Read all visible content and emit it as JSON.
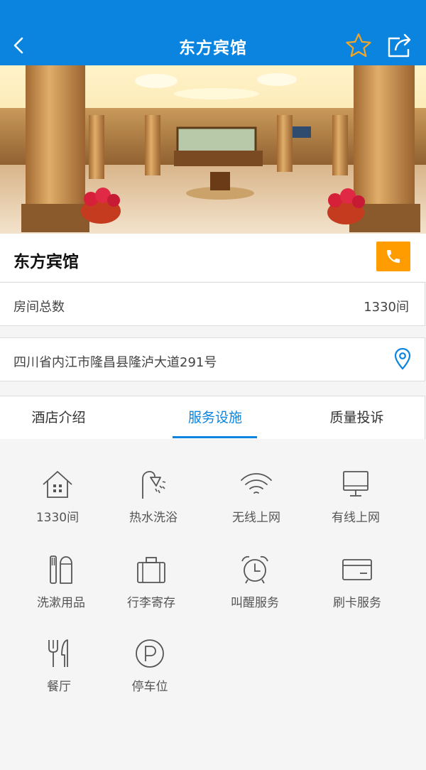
{
  "header": {
    "title": "东方宾馆",
    "back_icon": "back-arrow-icon",
    "favorite_icon": "star-icon",
    "share_icon": "share-icon",
    "bg_color": "#0a84de",
    "star_color": "#f5a623"
  },
  "hotel": {
    "name": "东方宾馆",
    "phone_icon": "phone-icon",
    "phone_color": "#ff9c00"
  },
  "rooms": {
    "label": "房间总数",
    "value": "1330间"
  },
  "address": {
    "text": "四川省内江市隆昌县隆泸大道291号",
    "icon": "location-pin-icon"
  },
  "tabs": [
    {
      "label": "酒店介绍",
      "active": false
    },
    {
      "label": "服务设施",
      "active": true
    },
    {
      "label": "质量投诉",
      "active": false
    }
  ],
  "facilities": [
    {
      "label": "1330间",
      "icon": "house-icon"
    },
    {
      "label": "热水洗浴",
      "icon": "shower-icon"
    },
    {
      "label": "无线上网",
      "icon": "wifi-icon"
    },
    {
      "label": "有线上网",
      "icon": "monitor-icon"
    },
    {
      "label": "洗漱用品",
      "icon": "toiletries-icon"
    },
    {
      "label": "行李寄存",
      "icon": "luggage-icon"
    },
    {
      "label": "叫醒服务",
      "icon": "alarm-clock-icon"
    },
    {
      "label": "刷卡服务",
      "icon": "credit-card-icon"
    },
    {
      "label": "餐厅",
      "icon": "restaurant-icon"
    },
    {
      "label": "停车位",
      "icon": "parking-icon"
    }
  ]
}
